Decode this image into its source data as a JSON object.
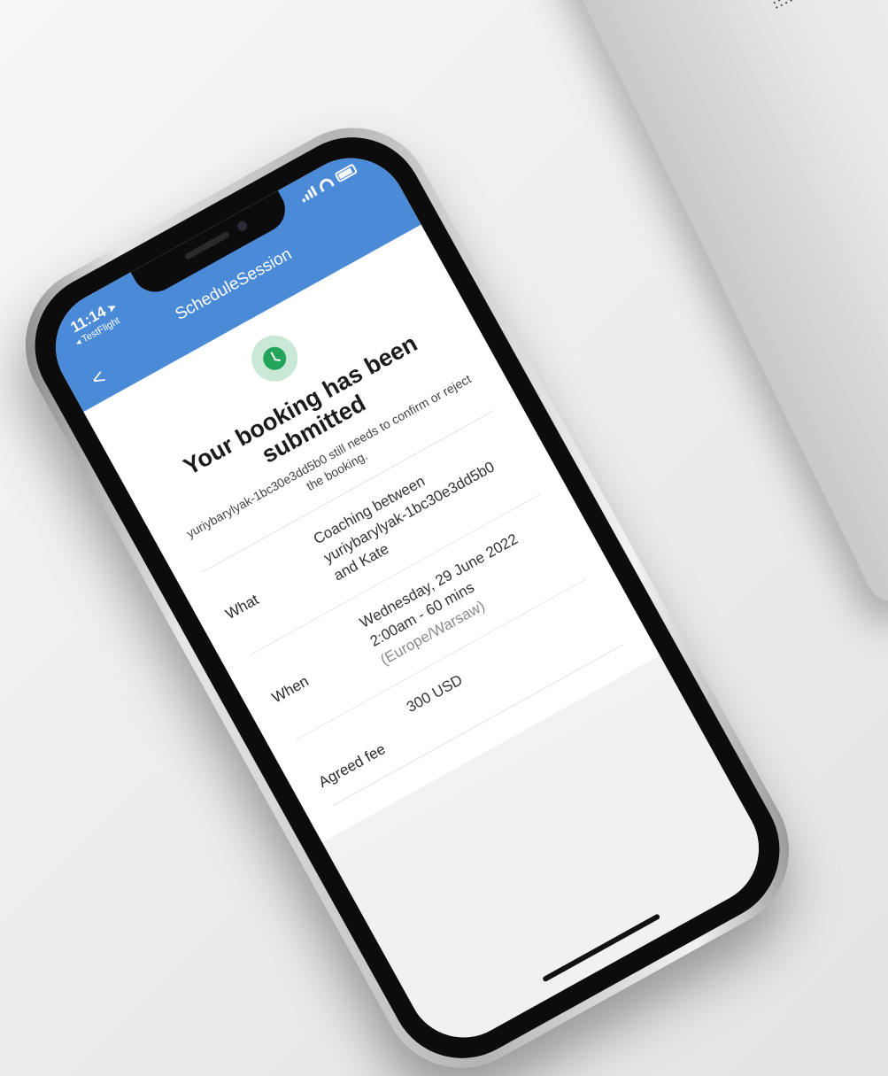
{
  "status_bar": {
    "time": "11:14",
    "location_arrow": "➤",
    "back_app": "◂ TestFlight"
  },
  "nav": {
    "title": "ScheduleSession",
    "back_glyph": "<"
  },
  "confirmation": {
    "icon": "clock-icon",
    "headline": "Your booking has been submitted",
    "subtext": "yuriybarylyak-1bc30e3dd5b0 still needs to confirm or reject the booking."
  },
  "details": {
    "what_label": "What",
    "what_value": "Coaching between yuriybarylyak-1bc30e3dd5b0 and Kate",
    "when_label": "When",
    "when_date": "Wednesday, 29 June 2022",
    "when_time": "2:00am - 60 mins",
    "when_timezone": "(Europe/Warsaw)",
    "fee_label": "Agreed fee",
    "fee_value": "300 USD"
  },
  "colors": {
    "header_blue": "#4a8ad6",
    "success_green": "#23a45a"
  }
}
